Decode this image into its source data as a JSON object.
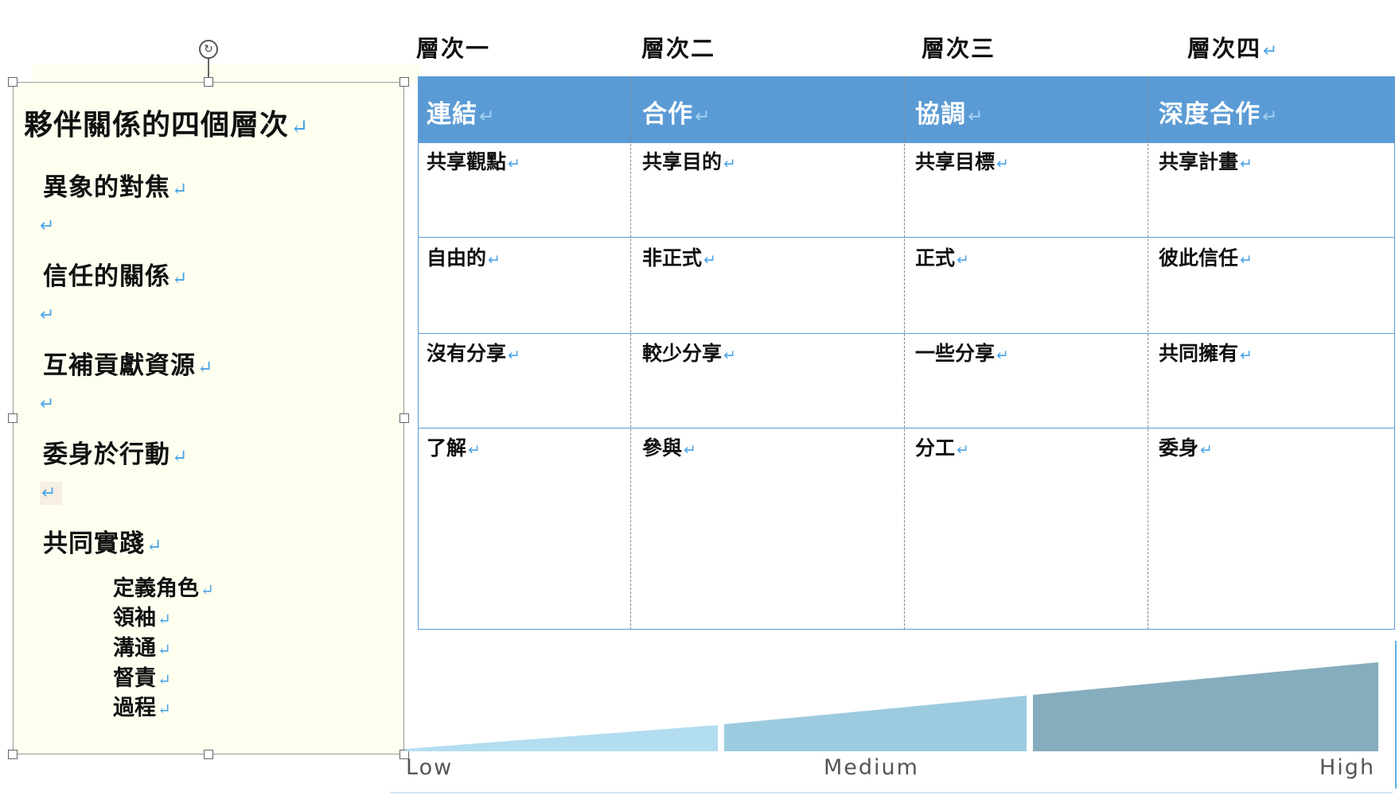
{
  "levels": [
    "層次一",
    "層次二",
    "層次三",
    "層次四"
  ],
  "left_panel": {
    "title": "夥伴關係的四個層次",
    "items": [
      "異象的對焦",
      "信任的關係",
      "互補貢獻資源",
      "委身於行動",
      "共同實踐"
    ],
    "sub_items": [
      "定義角色",
      "領袖",
      "溝通",
      "督責",
      "過程"
    ],
    "return_mark": "↵",
    "rotate_glyph": "↻"
  },
  "table": {
    "headers": [
      "連結",
      "合作",
      "協調",
      "深度合作"
    ],
    "rows": [
      [
        "共享觀點",
        "共享目的",
        "共享目標",
        "共享計畫"
      ],
      [
        "自由的",
        "非正式",
        "正式",
        "彼此信任"
      ],
      [
        "沒有分享",
        "較少分享",
        "一些分享",
        "共同擁有"
      ],
      [
        "了解",
        "參與",
        "分工",
        "委身"
      ]
    ]
  },
  "scale": {
    "labels": [
      "Low",
      "Medium",
      "High"
    ],
    "colors": [
      "#b3ddf0",
      "#9ccbe0",
      "#86adbd"
    ]
  },
  "colors": {
    "header_bg": "#5b9bd5",
    "panel_bg": "#fffff0",
    "return_mark": "#4aa3e6"
  }
}
